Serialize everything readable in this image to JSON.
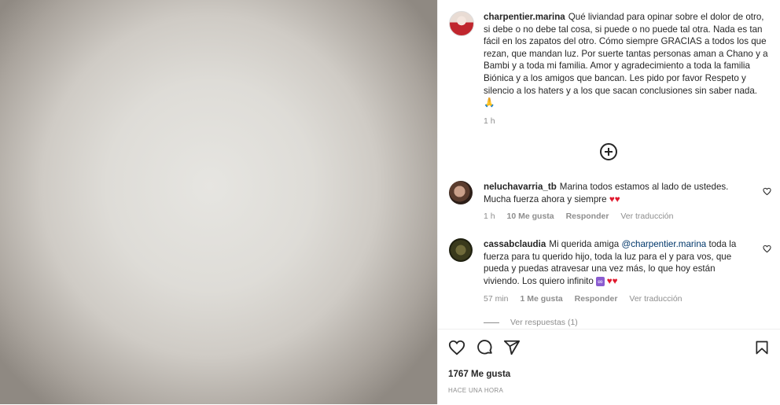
{
  "post": {
    "caption_user": "charpentier.marina",
    "caption_text": "Qué liviandad para opinar sobre el dolor de otro, si debe o no debe tal cosa, si puede o no puede tal otra. Nada es tan fácil en los zapatos del otro. Cómo siempre GRACIAS a todos los que rezan, que mandan luz. Por suerte tantas personas aman a Chano y a Bambi y a toda mi familia. Amor y agradecimiento a toda la familia Biónica y a los amigos que bancan. Les pido por favor Respeto y silencio a los haters y a los que sacan conclusiones sin saber nada.",
    "caption_emoji": "🙏",
    "caption_time": "1 h"
  },
  "comments": [
    {
      "user": "neluchavarria_tb",
      "text": "Marina todos estamos al lado de ustedes. Mucha fuerza ahora y siempre",
      "emoji": "♥♥",
      "time": "1 h",
      "likes": "10 Me gusta",
      "reply": "Responder",
      "translate": "Ver traducción"
    },
    {
      "user": "cassabclaudia",
      "mention": "@charpentier.marina",
      "text_before": "Mi querida amiga",
      "text_after": "toda la fuerza para tu querido hijo, toda la luz para el y para vos, que pueda y puedas atravesar una vez más, lo que hoy están viviendo. Los quiero infinito",
      "emoji_inf": "∞",
      "emoji": "♥♥",
      "time": "57 min",
      "likes": "1 Me gusta",
      "reply": "Responder",
      "translate": "Ver traducción",
      "view_replies": "Ver respuestas (1)"
    }
  ],
  "footer": {
    "likes": "1767 Me gusta",
    "timestamp": "HACE UNA HORA"
  },
  "icons": [
    "heart-icon",
    "comment-icon",
    "share-icon",
    "bookmark-icon",
    "add-circle-icon"
  ],
  "colors": {
    "text": "#262626",
    "muted": "#8e8e8e",
    "heart": "#e0182d",
    "link": "#00376b"
  }
}
